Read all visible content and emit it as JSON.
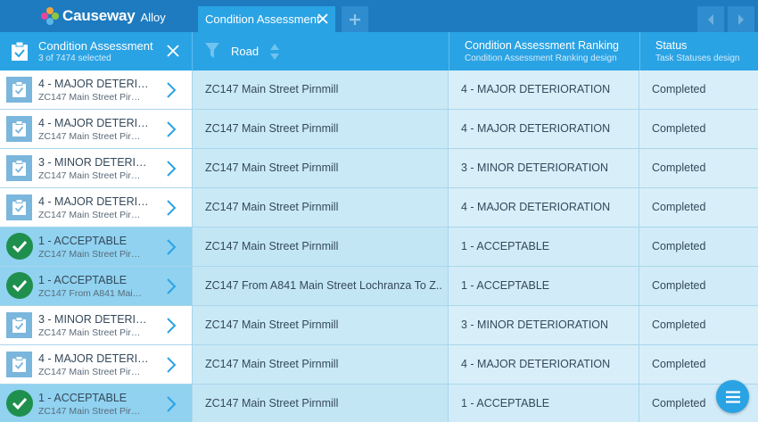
{
  "app": {
    "brand": "Causeway",
    "brand_sub": "Alloy"
  },
  "tabs": [
    {
      "label": "Condition Assessment",
      "active": true
    }
  ],
  "selection": {
    "title": "Condition Assessment",
    "count_text": "3 of 7474 selected"
  },
  "columns": {
    "road": {
      "label": "Road"
    },
    "ranking": {
      "title": "Condition Assessment Ranking",
      "subtitle": "Condition Assessment Ranking design"
    },
    "status": {
      "title": "Status",
      "subtitle": "Task Statuses design"
    }
  },
  "rows": [
    {
      "title": "4 - MAJOR DETERIORATION",
      "subtitle": "ZC147 Main Street Pirnmill",
      "road": "ZC147 Main Street Pirnmill",
      "ranking": "4 - MAJOR DETERIORATION",
      "status": "Completed",
      "selected": false
    },
    {
      "title": "4 - MAJOR DETERIORATION",
      "subtitle": "ZC147 Main Street Pirnmill",
      "road": "ZC147 Main Street Pirnmill",
      "ranking": "4 - MAJOR DETERIORATION",
      "status": "Completed",
      "selected": false
    },
    {
      "title": "3 - MINOR DETERIORATION",
      "subtitle": "ZC147 Main Street Pirnmill",
      "road": "ZC147 Main Street Pirnmill",
      "ranking": "3 - MINOR DETERIORATION",
      "status": "Completed",
      "selected": false
    },
    {
      "title": "4 - MAJOR DETERIORATION",
      "subtitle": "ZC147 Main Street Pirnmill",
      "road": "ZC147 Main Street Pirnmill",
      "ranking": "4 - MAJOR DETERIORATION",
      "status": "Completed",
      "selected": false
    },
    {
      "title": "1 - ACCEPTABLE",
      "subtitle": "ZC147 Main Street Pirnmill",
      "road": "ZC147 Main Street Pirnmill",
      "ranking": "1 - ACCEPTABLE",
      "status": "Completed",
      "selected": true
    },
    {
      "title": "1 - ACCEPTABLE",
      "subtitle": "ZC147 From A841 Main Street Lochranza To Z...",
      "road": "ZC147 From A841 Main Street Lochranza To Z...",
      "ranking": "1 - ACCEPTABLE",
      "status": "Completed",
      "selected": true
    },
    {
      "title": "3 - MINOR DETERIORATION",
      "subtitle": "ZC147 Main Street Pirnmill",
      "road": "ZC147 Main Street Pirnmill",
      "ranking": "3 - MINOR DETERIORATION",
      "status": "Completed",
      "selected": false
    },
    {
      "title": "4 - MAJOR DETERIORATION",
      "subtitle": "ZC147 Main Street Pirnmill",
      "road": "ZC147 Main Street Pirnmill",
      "ranking": "4 - MAJOR DETERIORATION",
      "status": "Completed",
      "selected": false
    },
    {
      "title": "1 - ACCEPTABLE",
      "subtitle": "ZC147 Main Street Pirnmill",
      "road": "ZC147 Main Street Pirnmill",
      "ranking": "1 - ACCEPTABLE",
      "status": "Completed",
      "selected": true
    }
  ],
  "colors": {
    "topbar": "#1e7bbf",
    "accent": "#2aa3e4",
    "selected_row": "#90d2f0",
    "check_green": "#1f8f4e"
  },
  "icons": {
    "selection": "clipboard-check-icon",
    "filter": "filter-icon",
    "sort": "sort-icon",
    "row_selected": "check-circle-icon",
    "row_unselected": "clipboard-check-icon",
    "fab": "menu-icon"
  }
}
